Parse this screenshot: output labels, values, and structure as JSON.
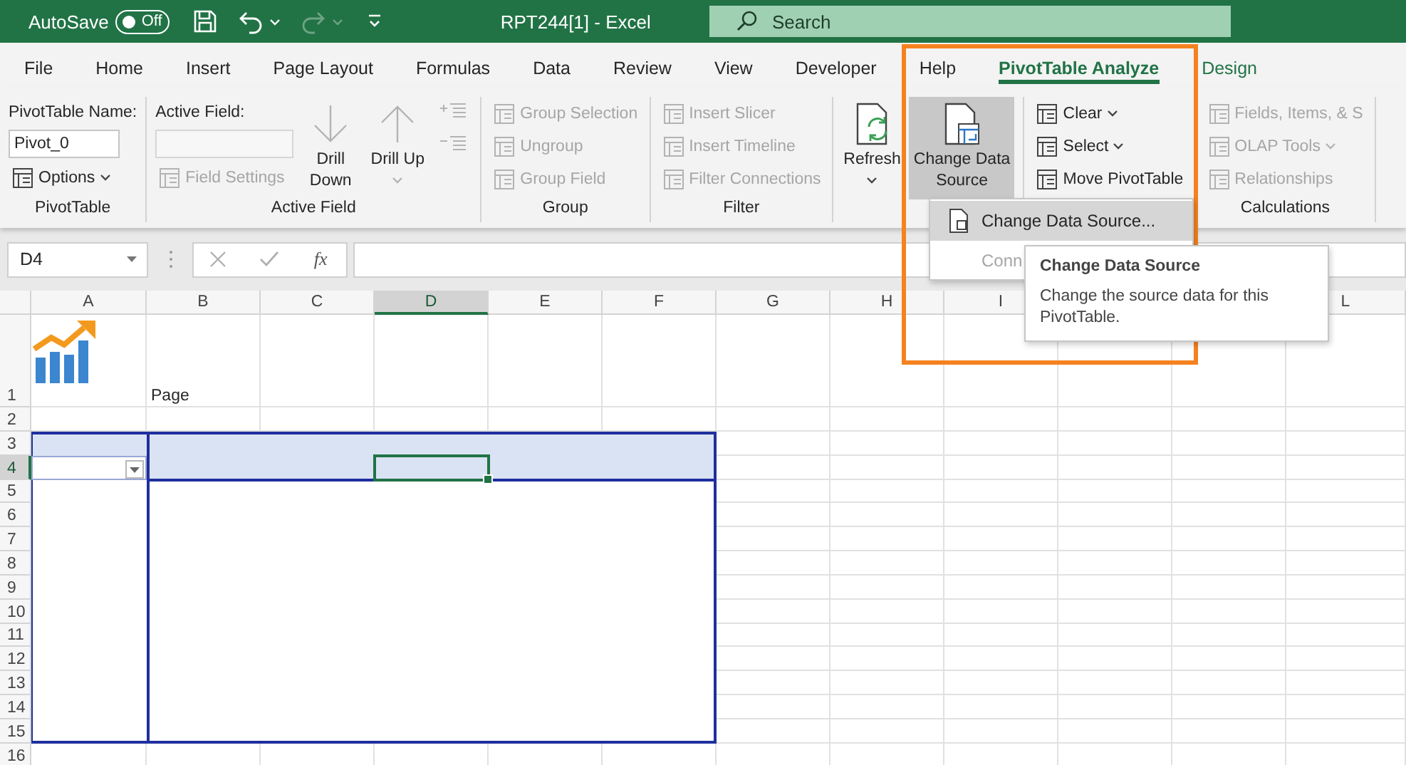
{
  "title_bar": {
    "autosave_label": "AutoSave",
    "autosave_toggle": {
      "label": "Off",
      "on": false
    },
    "redo_disabled": true,
    "title": "RPT244[1]  -  Excel",
    "search": {
      "placeholder": "Search"
    }
  },
  "tabs": [
    {
      "label": "File",
      "selected": false,
      "contextual": false
    },
    {
      "label": "Home",
      "selected": false,
      "contextual": false
    },
    {
      "label": "Insert",
      "selected": false,
      "contextual": false
    },
    {
      "label": "Page Layout",
      "selected": false,
      "contextual": false
    },
    {
      "label": "Formulas",
      "selected": false,
      "contextual": false
    },
    {
      "label": "Data",
      "selected": false,
      "contextual": false
    },
    {
      "label": "Review",
      "selected": false,
      "contextual": false
    },
    {
      "label": "View",
      "selected": false,
      "contextual": false
    },
    {
      "label": "Developer",
      "selected": false,
      "contextual": false
    },
    {
      "label": "Help",
      "selected": false,
      "contextual": false
    },
    {
      "label": "PivotTable Analyze",
      "selected": true,
      "contextual": true
    },
    {
      "label": "Design",
      "selected": false,
      "contextual": true
    }
  ],
  "ribbon": {
    "groups": [
      {
        "label": "PivotTable",
        "columns": [
          [
            {
              "kind": "caption",
              "label": "PivotTable Name:"
            },
            {
              "kind": "field",
              "value": "Pivot_0",
              "disabled": false
            },
            {
              "kind": "small",
              "label": "Options",
              "dropdown": true,
              "disabled": false
            }
          ]
        ]
      },
      {
        "label": "Active Field",
        "columns": [
          [
            {
              "kind": "caption",
              "label": "Active Field:"
            },
            {
              "kind": "field",
              "disabled": true
            },
            {
              "kind": "small",
              "label": "Field Settings",
              "dropdown": false,
              "disabled": true
            }
          ],
          [
            {
              "kind": "large",
              "label": "Drill Down",
              "dropdown": false,
              "disabled": true,
              "pressed": false
            }
          ],
          [
            {
              "kind": "large",
              "label": "Drill Up",
              "dropdown": true,
              "disabled": true,
              "pressed": false
            }
          ],
          [
            {
              "kind": "expand",
              "disabled": true
            },
            {
              "kind": "collapse",
              "disabled": true
            }
          ]
        ]
      },
      {
        "label": "Group",
        "columns": [
          [
            {
              "kind": "small",
              "label": "Group Selection",
              "dropdown": false,
              "disabled": true
            },
            {
              "kind": "small",
              "label": "Ungroup",
              "dropdown": false,
              "disabled": true
            },
            {
              "kind": "small",
              "label": "Group Field",
              "dropdown": false,
              "disabled": true
            }
          ]
        ]
      },
      {
        "label": "Filter",
        "columns": [
          [
            {
              "kind": "small",
              "label": "Insert Slicer",
              "dropdown": false,
              "disabled": true
            },
            {
              "kind": "small",
              "label": "Insert Timeline",
              "dropdown": false,
              "disabled": true
            },
            {
              "kind": "small",
              "label": "Filter Connections",
              "dropdown": false,
              "disabled": true
            }
          ]
        ]
      },
      {
        "columns": [
          [
            {
              "kind": "large",
              "label": "Refresh",
              "dropdown": true,
              "disabled": false,
              "pressed": false
            }
          ],
          [
            {
              "kind": "large",
              "label": "Change Data Source",
              "dropdown": true,
              "disabled": false,
              "pressed": true
            }
          ]
        ]
      },
      {
        "columns": [
          [
            {
              "kind": "small",
              "label": "Clear",
              "dropdown": true,
              "disabled": false
            },
            {
              "kind": "small",
              "label": "Select",
              "dropdown": true,
              "disabled": false
            },
            {
              "kind": "small",
              "label": "Move PivotTable",
              "dropdown": false,
              "disabled": false
            }
          ]
        ]
      },
      {
        "label": "Calculations",
        "columns": [
          [
            {
              "kind": "small",
              "label": "Fields, Items, & S",
              "dropdown": false,
              "disabled": true
            },
            {
              "kind": "small",
              "label": "OLAP Tools",
              "dropdown": true,
              "disabled": true
            },
            {
              "kind": "small",
              "label": "Relationships",
              "dropdown": false,
              "disabled": true
            }
          ]
        ]
      }
    ]
  },
  "formula_bar": {
    "name_box": "D4",
    "function_label": "fx"
  },
  "sheet": {
    "columns": [
      {
        "label": "A",
        "selected": false
      },
      {
        "label": "B",
        "selected": false
      },
      {
        "label": "C",
        "selected": false
      },
      {
        "label": "D",
        "selected": true
      },
      {
        "label": "E",
        "selected": false
      },
      {
        "label": "F",
        "selected": false
      },
      {
        "label": "G",
        "selected": false
      },
      {
        "label": "H",
        "selected": false
      },
      {
        "label": "I",
        "selected": false
      },
      {
        "label": "L",
        "selected": false
      }
    ],
    "rows": [
      {
        "label": "1",
        "selected": false,
        "cells": [
          {
            "kind": "logo"
          },
          {
            "kind": "text",
            "text": "Page"
          }
        ]
      },
      {
        "label": "2",
        "selected": false
      },
      {
        "label": "3",
        "selected": false
      },
      {
        "label": "4",
        "selected": true
      },
      {
        "label": "5",
        "selected": false
      },
      {
        "label": "6",
        "selected": false
      },
      {
        "label": "7",
        "selected": false
      },
      {
        "label": "8",
        "selected": false
      },
      {
        "label": "9",
        "selected": false
      },
      {
        "label": "10",
        "selected": false
      },
      {
        "label": "11",
        "selected": false
      },
      {
        "label": "12",
        "selected": false
      },
      {
        "label": "13",
        "selected": false
      },
      {
        "label": "14",
        "selected": false
      },
      {
        "label": "15",
        "selected": false
      },
      {
        "label": "16",
        "selected": false
      }
    ]
  },
  "menu": {
    "items": [
      {
        "label": "Change Data Source...",
        "highlighted": true,
        "disabled": false
      },
      {
        "label": "Conn",
        "highlighted": false,
        "disabled": true
      }
    ]
  },
  "tooltip": {
    "title": "Change Data Source",
    "description": "Change the source data for this PivotTable."
  }
}
